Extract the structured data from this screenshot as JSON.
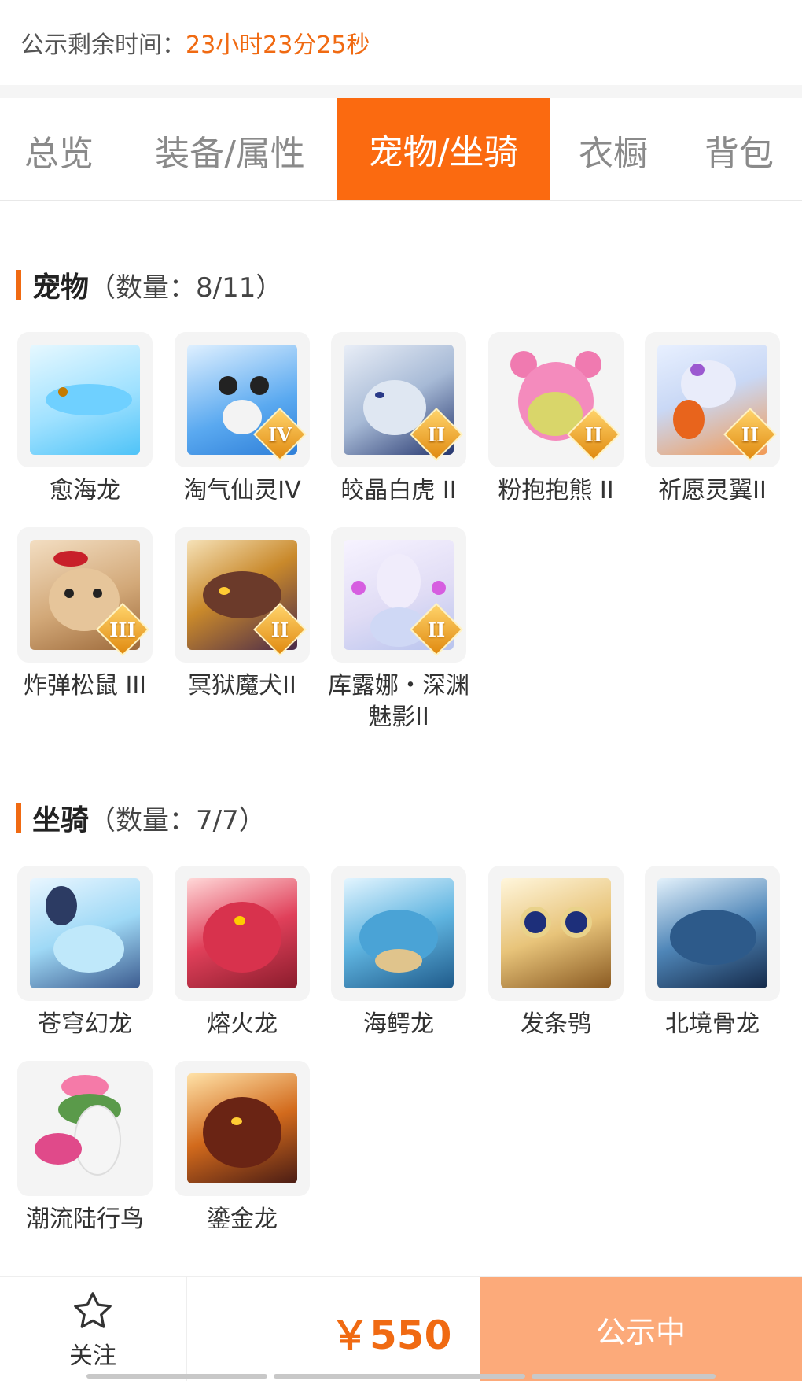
{
  "header": {
    "countdown_label": "公示剩余时间：",
    "countdown_value": "23小时23分25秒"
  },
  "tabs": [
    {
      "label": "总览"
    },
    {
      "label": "装备/属性"
    },
    {
      "label": "宠物/坐骑",
      "active": true
    },
    {
      "label": "衣橱"
    },
    {
      "label": "背包"
    }
  ],
  "pets": {
    "title": "宠物",
    "count": "（数量：8/11）",
    "items": [
      {
        "name": "愈海龙",
        "rank": ""
      },
      {
        "name": "淘气仙灵IV",
        "rank": "IV"
      },
      {
        "name": "皎晶白虎 II",
        "rank": "II"
      },
      {
        "name": "粉抱抱熊 II",
        "rank": "II"
      },
      {
        "name": "祈愿灵翼II",
        "rank": "II"
      },
      {
        "name": "炸弹松鼠 III",
        "rank": "III"
      },
      {
        "name": "冥狱魔犬II",
        "rank": "II"
      },
      {
        "name": "库露娜・深渊魅影II",
        "rank": "II"
      }
    ]
  },
  "mounts": {
    "title": "坐骑",
    "count": "（数量：7/7）",
    "items": [
      {
        "name": "苍穹幻龙"
      },
      {
        "name": "熔火龙"
      },
      {
        "name": "海鳄龙"
      },
      {
        "name": "发条鸮"
      },
      {
        "name": "北境骨龙"
      },
      {
        "name": "潮流陆行鸟"
      },
      {
        "name": "鎏金龙"
      }
    ]
  },
  "footer": {
    "follow_label": "关注",
    "price": "￥550",
    "status_button": "公示中"
  },
  "icons": {
    "follow": "star-outline-icon"
  },
  "colors": {
    "accent": "#f06a12",
    "active_tab": "#fb6a10",
    "status_button": "#fcaa7a"
  }
}
